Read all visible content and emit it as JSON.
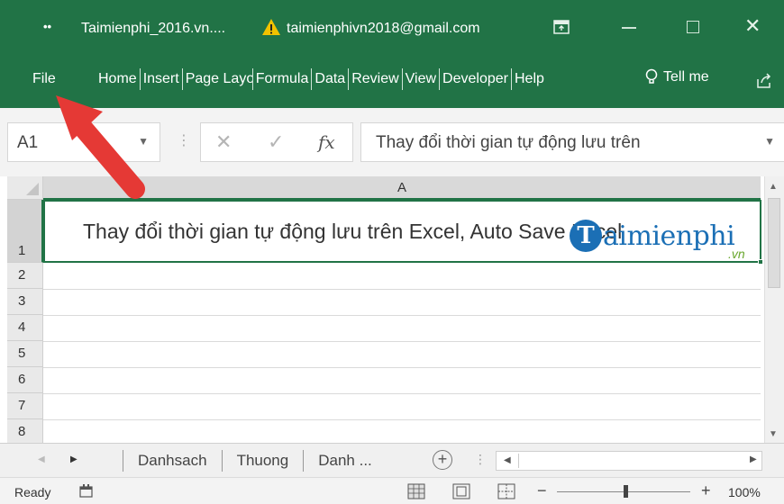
{
  "titlebar": {
    "qat": "••",
    "filename": "Taimienphi_2016.vn....",
    "account": "taimienphivn2018@gmail.com",
    "close_glyph": "✕"
  },
  "ribbon": {
    "file": "File",
    "tabs": [
      {
        "label": "Home",
        "width": 0
      },
      {
        "label": "Insert"
      },
      {
        "label": "Page Layout"
      },
      {
        "label": "Formula"
      },
      {
        "label": "Data"
      },
      {
        "label": "Review"
      },
      {
        "label": "View"
      },
      {
        "label": "Developer"
      },
      {
        "label": "Help"
      }
    ],
    "tell_me": "Tell me"
  },
  "formula_bar": {
    "name_box": "A1",
    "content": "Thay đổi thời gian tự động lưu trên"
  },
  "grid": {
    "column_header": "A",
    "rows": [
      "1",
      "2",
      "3",
      "4",
      "5",
      "6",
      "7",
      "8"
    ],
    "cell_a1": "Thay đổi thời gian tự động lưu trên Excel, Auto Save Excel"
  },
  "watermark": {
    "logo_letter": "T",
    "text": "aimienphi",
    "suffix": ".vn"
  },
  "sheets": {
    "tabs": [
      "Danhsach",
      "Thuong",
      "Danh ..."
    ],
    "add": "+"
  },
  "status": {
    "ready": "Ready",
    "zoom": "100%"
  },
  "colors": {
    "excel_green": "#217346",
    "arrow_red": "#e53935",
    "watermark_blue": "#1b6fb5"
  }
}
